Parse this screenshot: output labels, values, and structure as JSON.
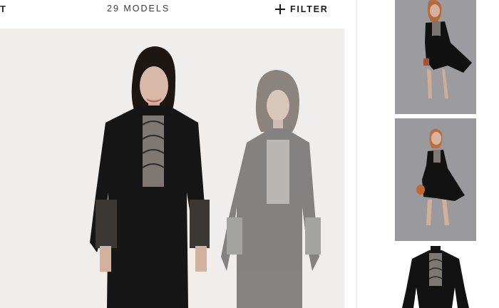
{
  "header": {
    "back_fragment": "T",
    "models_count": "29 MODELS",
    "filter_label": "FILTER"
  },
  "colors": {
    "hero_background": "#efeeec",
    "thumb_background": "#9c9ca0",
    "dress": "#161616",
    "lace": "#7d7873"
  },
  "gallery": {
    "thumbnails": [
      "model-standing-front",
      "model-holding-bag",
      "dress-closeup"
    ]
  }
}
